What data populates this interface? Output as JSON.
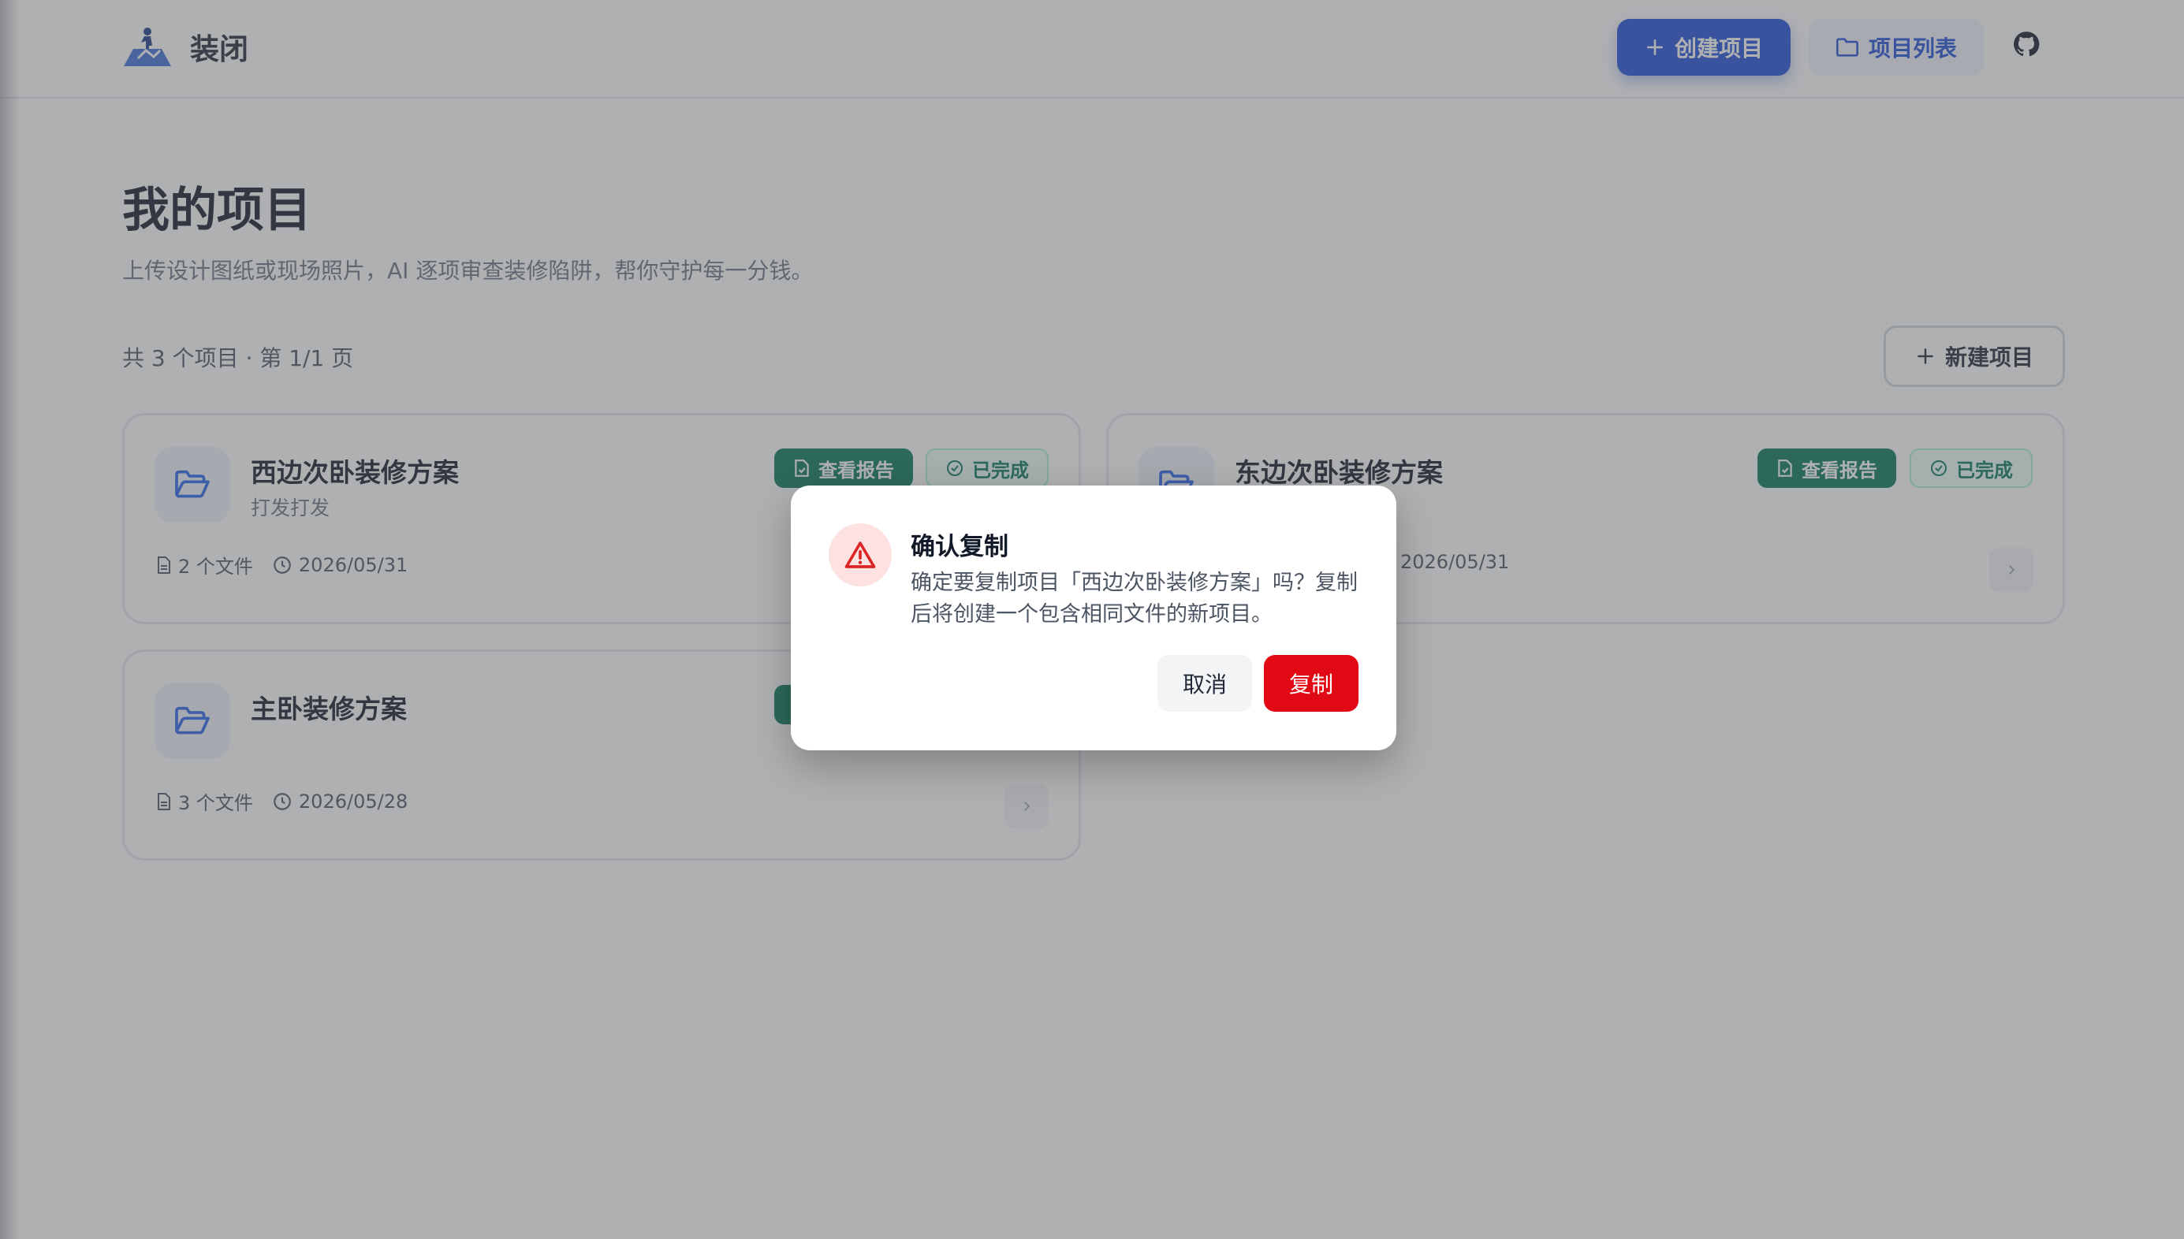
{
  "app": {
    "name": "装闭",
    "colors": {
      "primary": "#1d4ed8",
      "success": "#047857",
      "danger": "#e10a14"
    }
  },
  "header": {
    "create_label": "创建项目",
    "list_label": "项目列表",
    "github_icon": "github-icon"
  },
  "main": {
    "title": "我的项目",
    "subtitle": "上传设计图纸或现场照片，AI 逐项审查装修陷阱，帮你守护每一分钱。",
    "count_text": "共 3 个项目 · 第 1/1 页",
    "new_project_label": "新建项目"
  },
  "projects": [
    {
      "name": "西边次卧装修方案",
      "desc": "打发打发",
      "files": "2 个文件",
      "date": "2026/05/31",
      "report_label": "查看报告",
      "status": "已完成"
    },
    {
      "name": "东边次卧装修方案",
      "desc": "",
      "files": "",
      "date": "2026/05/31",
      "report_label": "查看报告",
      "status": "已完成"
    },
    {
      "name": "主卧装修方案",
      "desc": "",
      "files": "3 个文件",
      "date": "2026/05/28",
      "report_label": "",
      "status": ""
    }
  ],
  "dialog": {
    "title": "确认复制",
    "message": "确定要复制项目「西边次卧装修方案」吗？复制后将创建一个包含相同文件的新项目。",
    "cancel_label": "取消",
    "confirm_label": "复制"
  }
}
